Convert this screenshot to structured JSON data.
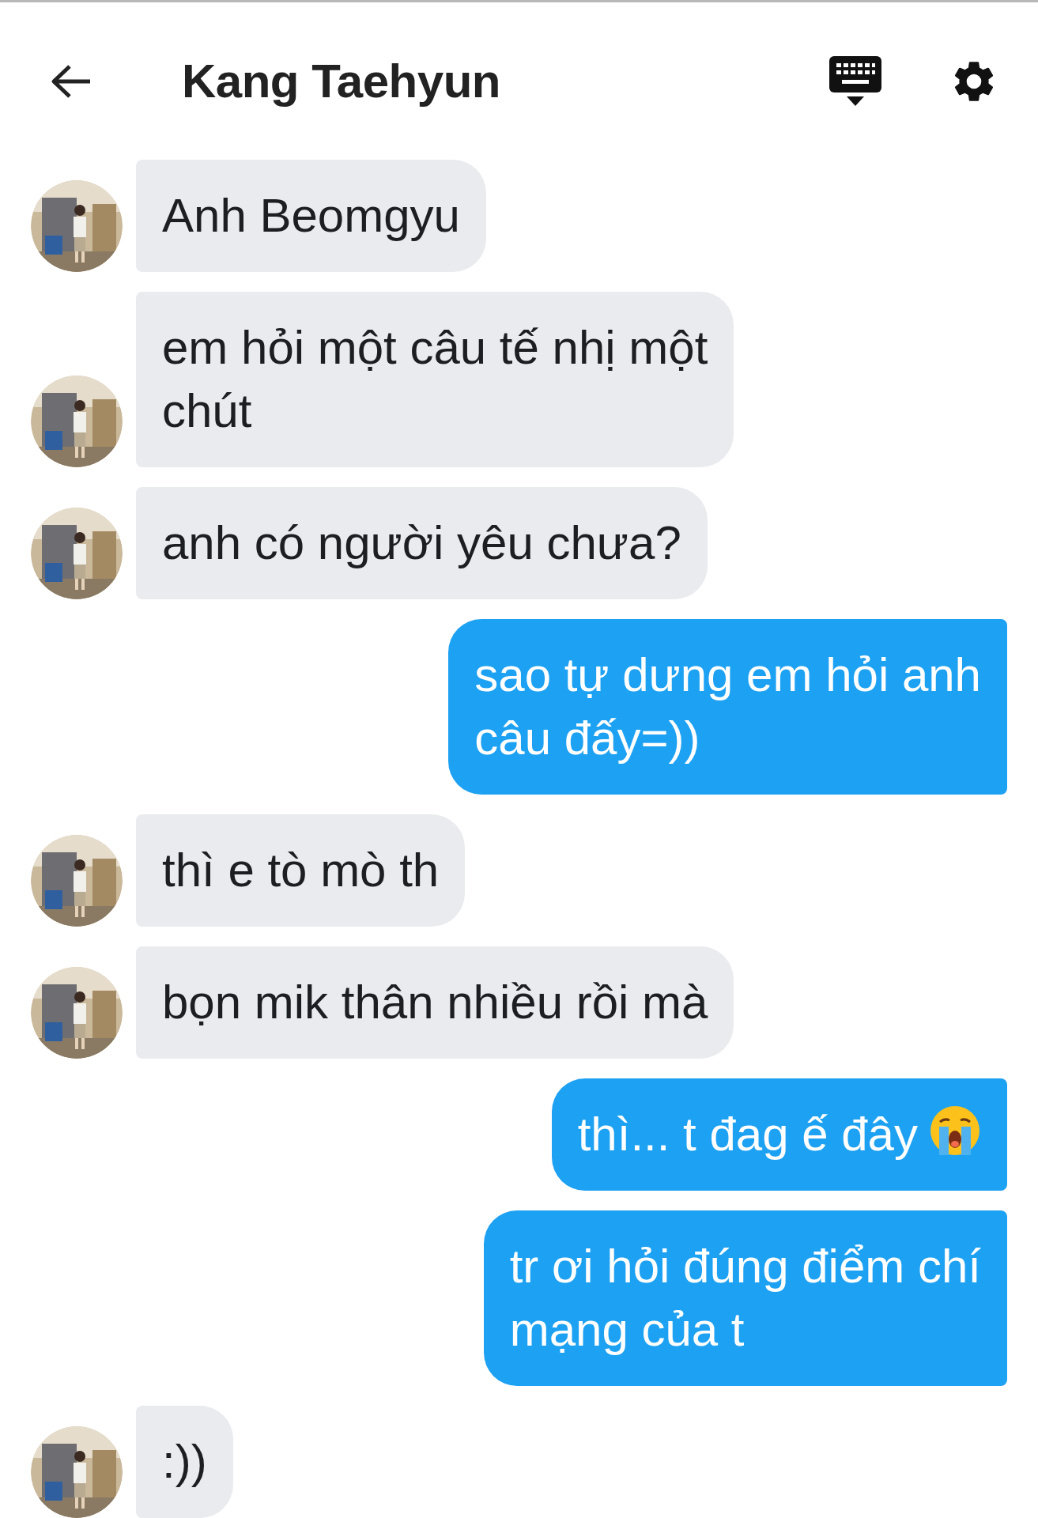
{
  "header": {
    "title": "Kang Taehyun"
  },
  "messages": [
    {
      "kind": "received",
      "text": "Anh Beomgyu"
    },
    {
      "kind": "received",
      "text": "em hỏi một câu tế nhị một\nchút"
    },
    {
      "kind": "received",
      "text": "anh có người yêu chưa?"
    },
    {
      "kind": "sent",
      "text": "sao tự dưng em hỏi anh\ncâu đấy=))"
    },
    {
      "kind": "received",
      "text": "thì e tò mò th"
    },
    {
      "kind": "received",
      "text": "bọn mik thân nhiều rồi mà"
    },
    {
      "kind": "sent",
      "text": "thì... t đag ế đây",
      "trailing_emoji": true
    },
    {
      "kind": "sent",
      "text": "tr ơi hỏi đúng điểm chí\nmạng của t"
    },
    {
      "kind": "received",
      "text": ":))"
    }
  ]
}
